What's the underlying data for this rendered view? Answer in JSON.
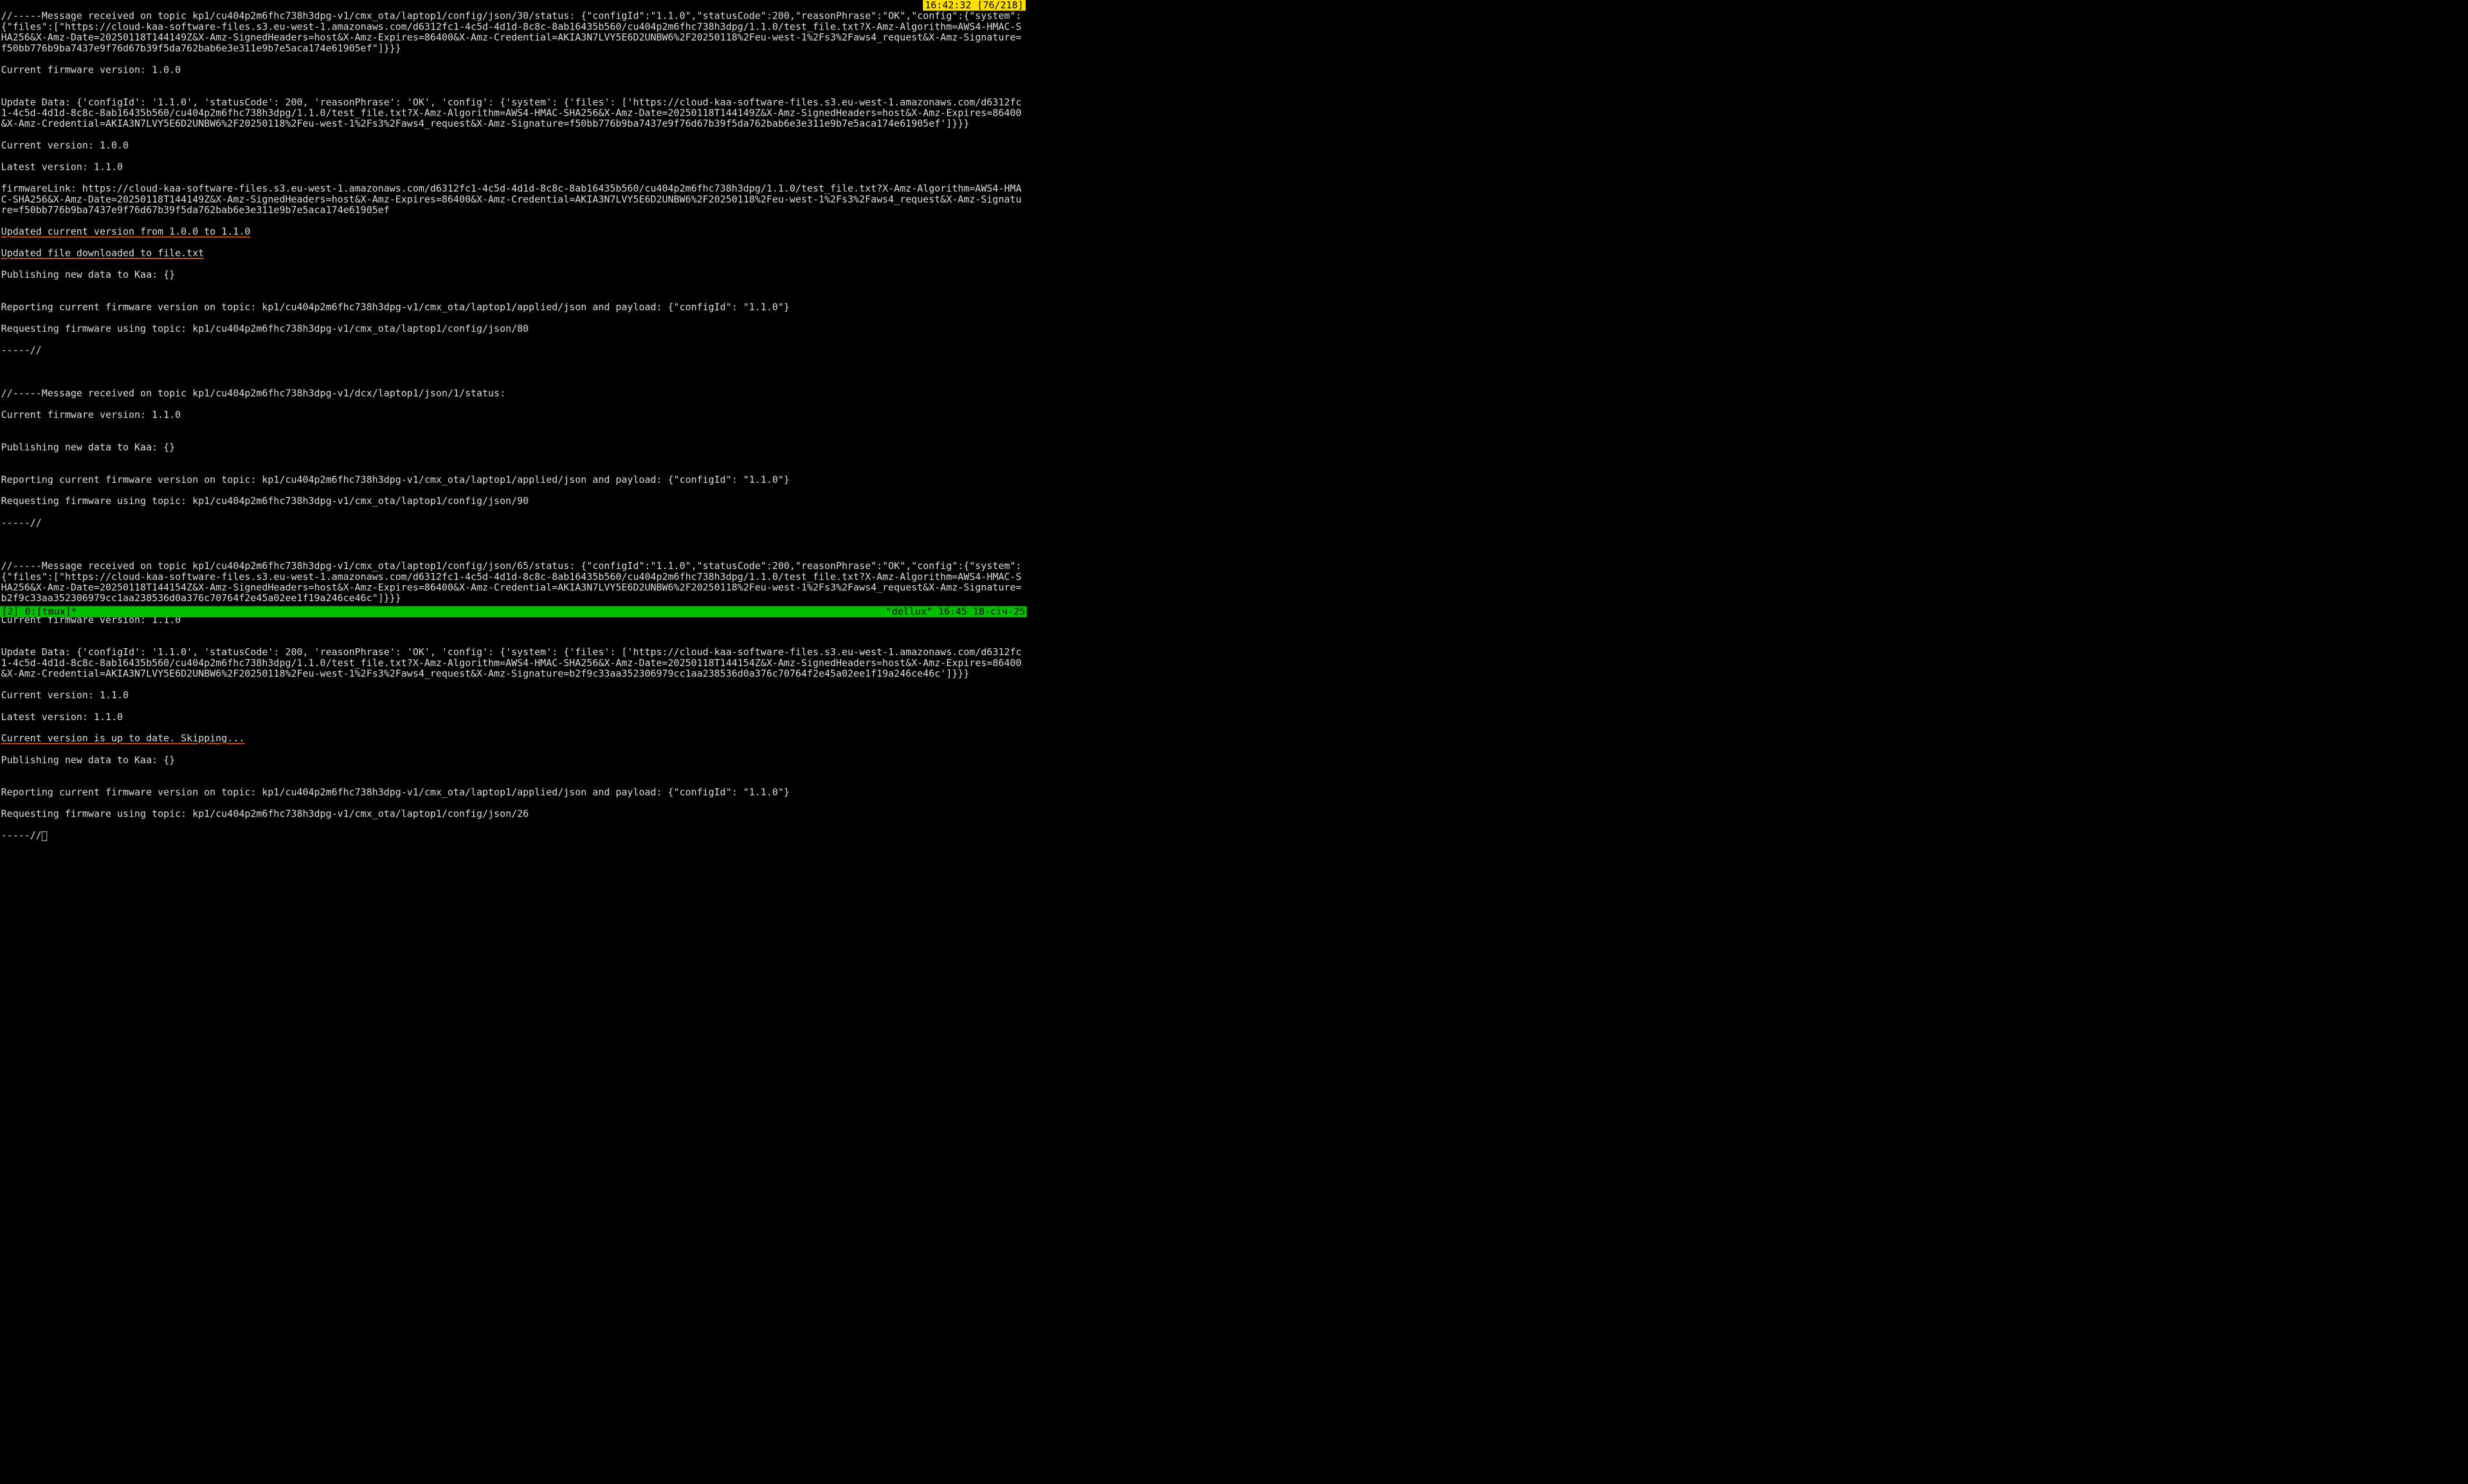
{
  "top_right_badge": "16:42:32 [76/218]",
  "lines": {
    "l01": "//-----Message received on topic kp1/cu404p2m6fhc738h3dpg-v1/cmx_ota/laptop1/config/json/30/status: {\"configId\":\"1.1.0\",\"statusCode\":200,\"reasonPhrase\":\"OK\",\"config\":{\"system\":{\"files\":[\"https://cloud-kaa-software-files.s3.eu-west-1.amazonaws.com/d6312fc1-4c5d-4d1d-8c8c-8ab16435b560/cu404p2m6fhc738h3dpg/1.1.0/test_file.txt?X-Amz-Algorithm=AWS4-HMAC-SHA256&X-Amz-Date=20250118T144149Z&X-Amz-SignedHeaders=host&X-Amz-Expires=86400&X-Amz-Credential=AKIA3N7LVY5E6D2UNBW6%2F20250118%2Feu-west-1%2Fs3%2Faws4_request&X-Amz-Signature=f50bb776b9ba7437e9f76d67b39f5da762bab6e3e311e9b7e5aca174e61905ef\"]}}}",
    "l02": "Current firmware version: 1.0.0",
    "l03": "",
    "l04": "Update Data: {'configId': '1.1.0', 'statusCode': 200, 'reasonPhrase': 'OK', 'config': {'system': {'files': ['https://cloud-kaa-software-files.s3.eu-west-1.amazonaws.com/d6312fc1-4c5d-4d1d-8c8c-8ab16435b560/cu404p2m6fhc738h3dpg/1.1.0/test_file.txt?X-Amz-Algorithm=AWS4-HMAC-SHA256&X-Amz-Date=20250118T144149Z&X-Amz-SignedHeaders=host&X-Amz-Expires=86400&X-Amz-Credential=AKIA3N7LVY5E6D2UNBW6%2F20250118%2Feu-west-1%2Fs3%2Faws4_request&X-Amz-Signature=f50bb776b9ba7437e9f76d67b39f5da762bab6e3e311e9b7e5aca174e61905ef']}}}",
    "l05": "Current version: 1.0.0",
    "l06": "Latest version: 1.1.0",
    "l07": "firmwareLink: https://cloud-kaa-software-files.s3.eu-west-1.amazonaws.com/d6312fc1-4c5d-4d1d-8c8c-8ab16435b560/cu404p2m6fhc738h3dpg/1.1.0/test_file.txt?X-Amz-Algorithm=AWS4-HMAC-SHA256&X-Amz-Date=20250118T144149Z&X-Amz-SignedHeaders=host&X-Amz-Expires=86400&X-Amz-Credential=AKIA3N7LVY5E6D2UNBW6%2F20250118%2Feu-west-1%2Fs3%2Faws4_request&X-Amz-Signature=f50bb776b9ba7437e9f76d67b39f5da762bab6e3e311e9b7e5aca174e61905ef",
    "l08u": "Updated current version from 1.0.0 to 1.1.0",
    "l09u": "Updated file downloaded to file.txt",
    "l10": "Publishing new data to Kaa: {}",
    "l11": "",
    "l12": "Reporting current firmware version on topic: kp1/cu404p2m6fhc738h3dpg-v1/cmx_ota/laptop1/applied/json and payload: {\"configId\": \"1.1.0\"}",
    "l13": "Requesting firmware using topic: kp1/cu404p2m6fhc738h3dpg-v1/cmx_ota/laptop1/config/json/80",
    "l14": "-----//",
    "l15": "",
    "l16": "",
    "l17": "//-----Message received on topic kp1/cu404p2m6fhc738h3dpg-v1/dcx/laptop1/json/1/status:",
    "l18": "Current firmware version: 1.1.0",
    "l19": "",
    "l20": "Publishing new data to Kaa: {}",
    "l21": "",
    "l22": "Reporting current firmware version on topic: kp1/cu404p2m6fhc738h3dpg-v1/cmx_ota/laptop1/applied/json and payload: {\"configId\": \"1.1.0\"}",
    "l23": "Requesting firmware using topic: kp1/cu404p2m6fhc738h3dpg-v1/cmx_ota/laptop1/config/json/90",
    "l24": "-----//",
    "l25": "",
    "l26": "",
    "l27": "//-----Message received on topic kp1/cu404p2m6fhc738h3dpg-v1/cmx_ota/laptop1/config/json/65/status: {\"configId\":\"1.1.0\",\"statusCode\":200,\"reasonPhrase\":\"OK\",\"config\":{\"system\":{\"files\":[\"https://cloud-kaa-software-files.s3.eu-west-1.amazonaws.com/d6312fc1-4c5d-4d1d-8c8c-8ab16435b560/cu404p2m6fhc738h3dpg/1.1.0/test_file.txt?X-Amz-Algorithm=AWS4-HMAC-SHA256&X-Amz-Date=20250118T144154Z&X-Amz-SignedHeaders=host&X-Amz-Expires=86400&X-Amz-Credential=AKIA3N7LVY5E6D2UNBW6%2F20250118%2Feu-west-1%2Fs3%2Faws4_request&X-Amz-Signature=b2f9c33aa352306979cc1aa238536d0a376c70764f2e45a02ee1f19a246ce46c\"]}}}",
    "l28": "Current firmware version: 1.1.0",
    "l29": "",
    "l30": "Update Data: {'configId': '1.1.0', 'statusCode': 200, 'reasonPhrase': 'OK', 'config': {'system': {'files': ['https://cloud-kaa-software-files.s3.eu-west-1.amazonaws.com/d6312fc1-4c5d-4d1d-8c8c-8ab16435b560/cu404p2m6fhc738h3dpg/1.1.0/test_file.txt?X-Amz-Algorithm=AWS4-HMAC-SHA256&X-Amz-Date=20250118T144154Z&X-Amz-SignedHeaders=host&X-Amz-Expires=86400&X-Amz-Credential=AKIA3N7LVY5E6D2UNBW6%2F20250118%2Feu-west-1%2Fs3%2Faws4_request&X-Amz-Signature=b2f9c33aa352306979cc1aa238536d0a376c70764f2e45a02ee1f19a246ce46c']}}}",
    "l31": "Current version: 1.1.0",
    "l32": "Latest version: 1.1.0",
    "l33u": "Current version is up to date. Skipping...",
    "l34": "Publishing new data to Kaa: {}",
    "l35": "",
    "l36": "Reporting current firmware version on topic: kp1/cu404p2m6fhc738h3dpg-v1/cmx_ota/laptop1/applied/json and payload: {\"configId\": \"1.1.0\"}",
    "l37": "Requesting firmware using topic: kp1/cu404p2m6fhc738h3dpg-v1/cmx_ota/laptop1/config/json/26",
    "l38": "-----//"
  },
  "statusbar": {
    "left": "[2] 0:[tmux]*",
    "right": "\"dellux\" 16:45 18-січ-25"
  },
  "colors": {
    "fg": "#dddddd",
    "bg": "#000000",
    "status_bg": "#00c000",
    "status_fg": "#000000",
    "badge_bg": "#ffe000",
    "underline": "#e06020"
  }
}
